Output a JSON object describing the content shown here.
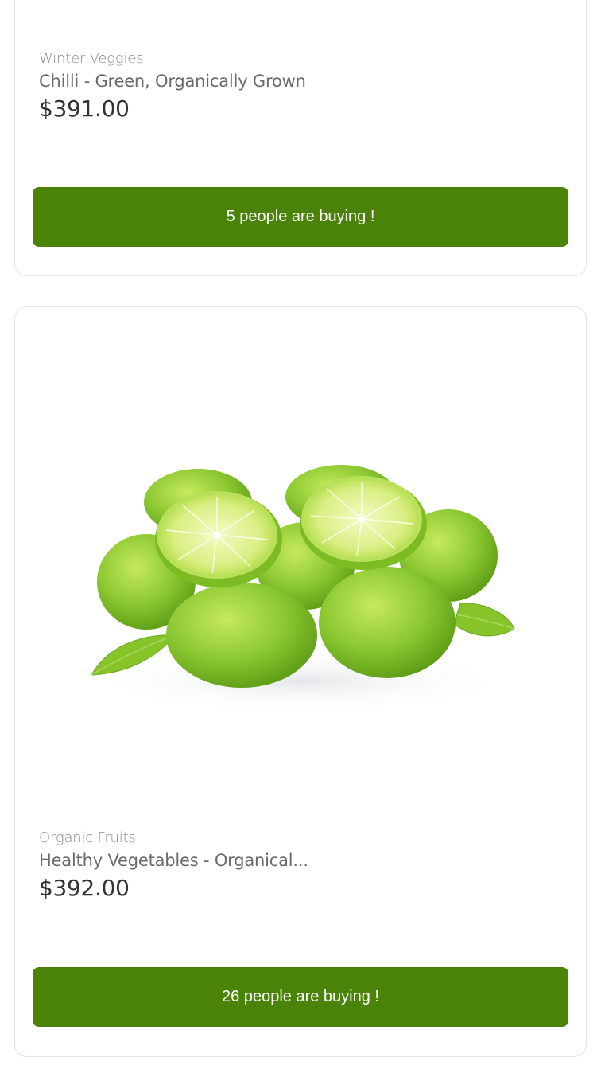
{
  "products": [
    {
      "category": "Winter Veggies",
      "title": "Chilli - Green, Organically Grown",
      "price": "$391.00",
      "buying_label": "5 people are buying !"
    },
    {
      "category": "Organic Fruits",
      "title": "Healthy Vegetables - Organical...",
      "price": "$392.00",
      "buying_label": "26 people are buying !",
      "image": "limes-image",
      "colors": {
        "lime_dark": "#5fa416",
        "lime_mid": "#86c42e",
        "lime_light": "#b7e04f",
        "lime_flesh": "#e6f59a",
        "leaf": "#7cc020"
      }
    }
  ],
  "colors": {
    "button_bg": "#4a8307",
    "button_text": "#ffffff",
    "card_border": "#e3e3e3",
    "price_text": "#333333",
    "title_text": "#6b6b6b",
    "category_text": "#8a8a8a"
  }
}
